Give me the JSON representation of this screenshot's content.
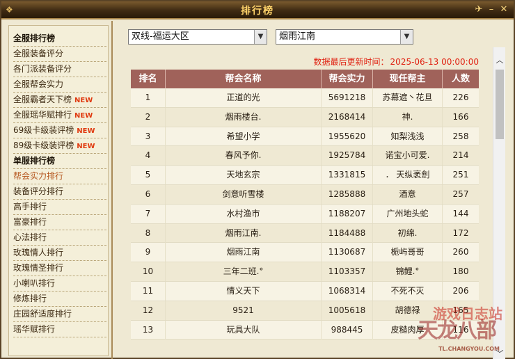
{
  "window": {
    "title": "排行榜",
    "buttons": [
      "✈",
      "–",
      "✕"
    ]
  },
  "sidebar": {
    "items": [
      {
        "label": "全服排行榜",
        "type": "header"
      },
      {
        "label": "全服装备评分"
      },
      {
        "label": "各门派装备评分"
      },
      {
        "label": "全服帮会实力"
      },
      {
        "label": "全服霸者天下榜",
        "badge": "NEW"
      },
      {
        "label": "全服瑶华赋排行",
        "badge": "NEW"
      },
      {
        "label": "69级卡级装评榜",
        "badge": "NEW"
      },
      {
        "label": "89级卡级装评榜",
        "badge": "NEW"
      },
      {
        "label": "单服排行榜",
        "type": "header"
      },
      {
        "label": "帮会实力排行",
        "active": true
      },
      {
        "label": "装备评分排行"
      },
      {
        "label": "高手排行"
      },
      {
        "label": "富豪排行"
      },
      {
        "label": "心法排行"
      },
      {
        "label": "玫瑰情人排行"
      },
      {
        "label": "玫瑰情圣排行"
      },
      {
        "label": "小喇叭排行"
      },
      {
        "label": "修炼排行"
      },
      {
        "label": "庄园舒适度排行"
      },
      {
        "label": "瑶华赋排行"
      }
    ]
  },
  "filters": {
    "server_group": "双线-福运大区",
    "server": "烟雨江南"
  },
  "update": {
    "label": "数据最后更新时间：",
    "time": "2025-06-13 00:00:00"
  },
  "table": {
    "headers": [
      "排名",
      "帮会名称",
      "帮会实力",
      "现任帮主",
      "人数"
    ],
    "rows": [
      [
        "1",
        "正道的光",
        "5691218",
        "苏幕遮丶花旦",
        "226"
      ],
      [
        "2",
        "烟雨楼台.",
        "2168414",
        "神.",
        "166"
      ],
      [
        "3",
        "希望小学",
        "1955620",
        "知梨浅浅",
        "258"
      ],
      [
        "4",
        "春风予你.",
        "1925784",
        "诺宝小可爱.",
        "214"
      ],
      [
        "5",
        "天地玄宗",
        "1331815",
        "． 天纵袤劍",
        "251"
      ],
      [
        "6",
        "剑意听雪楼",
        "1285888",
        "酒意",
        "257"
      ],
      [
        "7",
        "水村渔市",
        "1188207",
        "广州地头蛇",
        "144"
      ],
      [
        "8",
        "烟雨江南.",
        "1184488",
        "初绵.",
        "172"
      ],
      [
        "9",
        "烟雨江南",
        "1130687",
        "栀屿哥哥",
        "260"
      ],
      [
        "10",
        "三年二班.°",
        "1103357",
        "锦鲤.°",
        "180"
      ],
      [
        "11",
        "情义天下",
        "1068314",
        "不死不灭",
        "206"
      ],
      [
        "12",
        "9521",
        "1005618",
        "胡德禄",
        "165"
      ],
      [
        "13",
        "玩具大队",
        "988445",
        "皮糙肉厚",
        "116"
      ]
    ]
  },
  "watermark": {
    "site": "游戏日志站",
    "logo": "天龙八部",
    "url": "TL.CHANGYOU.COM"
  }
}
